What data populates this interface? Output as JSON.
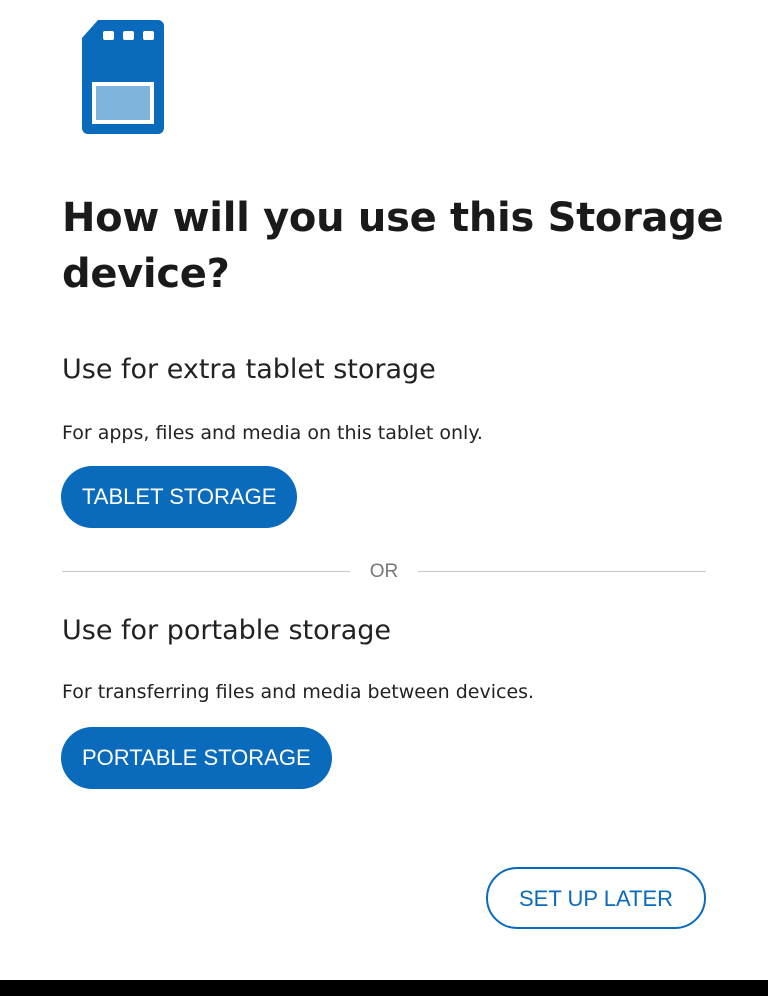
{
  "header": {
    "icon": "sd-card-icon",
    "title": "How will you use this Storage device?"
  },
  "tablet_option": {
    "heading": "Use for extra tablet storage",
    "description": "For apps, files and media on this tablet only.",
    "button_label": "TABLET STORAGE"
  },
  "divider": {
    "label": "OR"
  },
  "portable_option": {
    "heading": "Use for portable storage",
    "description": "For transferring files and media between devices.",
    "button_label": "PORTABLE STORAGE"
  },
  "footer": {
    "setup_later_label": "SET UP LATER"
  },
  "colors": {
    "accent": "#0a6bbd",
    "icon_window": "#7fb4dd",
    "text": "#1a1a1a",
    "divider": "#c8c8c8",
    "divider_text": "#777777"
  }
}
